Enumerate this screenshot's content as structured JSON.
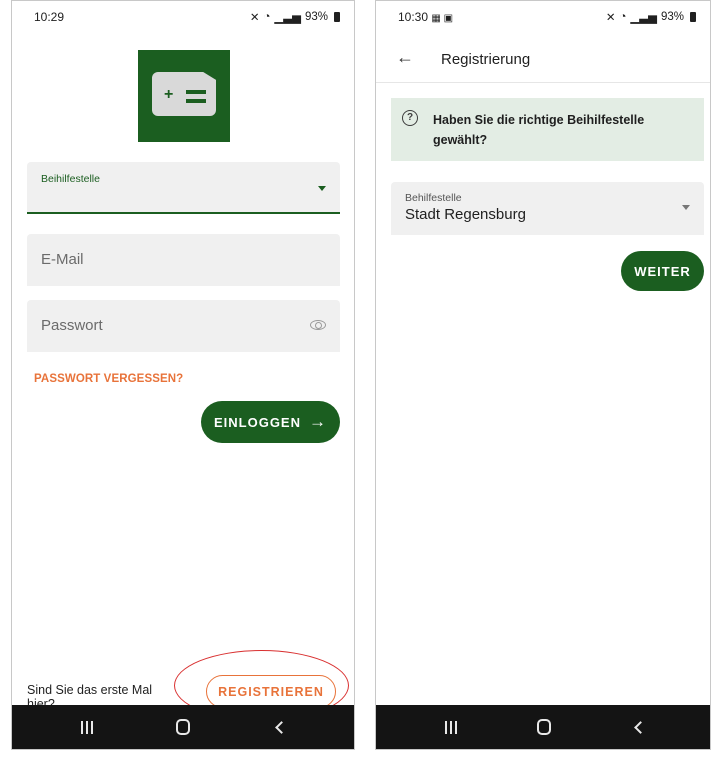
{
  "login_screen": {
    "status": {
      "time": "10:29",
      "battery": "93%"
    },
    "agency_field": {
      "label": "Beihilfestelle"
    },
    "email_field": {
      "placeholder": "E-Mail"
    },
    "password_field": {
      "placeholder": "Passwort"
    },
    "forgot_link": "PASSWORT VERGESSEN?",
    "login_button": {
      "label": "EINLOGGEN",
      "icon": "arrow-right-icon"
    },
    "first_time_text": "Sind Sie das erste Mal hier?",
    "register_button": "REGISTRIEREN",
    "colors": {
      "primary": "#1b5e20",
      "accent": "#e8733a",
      "highlight": "#d93030"
    }
  },
  "register_screen": {
    "status": {
      "time": "10:30",
      "battery": "93%"
    },
    "appbar": {
      "title": "Registrierung",
      "back_icon": "arrow-left-icon"
    },
    "info_box": {
      "text": "Haben Sie die richtige Beihilfestelle gewählt?",
      "icon": "question-circle-icon",
      "background": "#e3ede4"
    },
    "agency_select": {
      "label": "Behilfestelle",
      "value": "Stadt Regensburg"
    },
    "next_button": "WEITER"
  },
  "navbar": {
    "icons": [
      "recent-apps-icon",
      "home-icon",
      "back-icon"
    ]
  }
}
